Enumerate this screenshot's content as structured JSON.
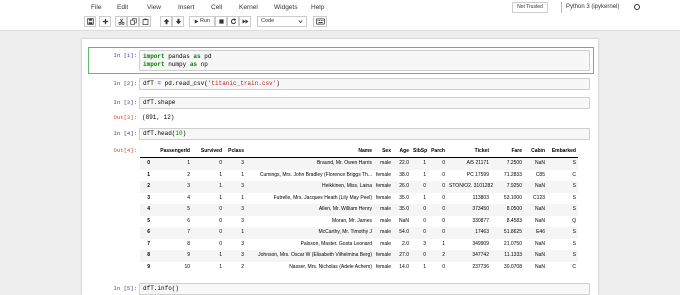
{
  "menu": {
    "items": [
      "File",
      "Edit",
      "View",
      "Insert",
      "Cell",
      "Kernel",
      "Widgets",
      "Help"
    ],
    "trust_label": "Not Trusted",
    "kernel_name": "Python 3 (ipykernel)",
    "kernel_status_icon": "circle-icon"
  },
  "toolbar": {
    "run_label": "Run",
    "cell_type": "Code",
    "icons": [
      "save-icon",
      "plus-icon",
      "cut-icon",
      "copy-icon",
      "paste-icon",
      "arrow-up-icon",
      "arrow-down-icon",
      "play-icon",
      "stop-icon",
      "restart-icon",
      "fast-forward-icon",
      "chevron-down-icon",
      "keyboard-icon"
    ]
  },
  "colors": {
    "selected_cell_border": "#66bb6a",
    "input_prompt": "#303f9f",
    "output_prompt": "#d84315",
    "keyword": "#008000",
    "string": "#ba2121",
    "number": "#008800",
    "operator": "#aa22ff"
  },
  "cells": [
    {
      "prompt": "In [1]:",
      "lines": [
        [
          "import",
          " pandas ",
          "as",
          " pd"
        ],
        [
          "import",
          " numpy ",
          "as",
          " np"
        ]
      ]
    },
    {
      "prompt": "In [2]:",
      "lines": [
        [
          "dfT ",
          "=",
          " pd.read_csv(",
          "'titanic_train.csv'",
          ")"
        ]
      ]
    },
    {
      "prompt": "In [3]:",
      "lines": [
        [
          "dfT.shape"
        ]
      ],
      "out_prompt": "Out[3]:",
      "output": "(891, 12)"
    },
    {
      "prompt": "In [4]:",
      "lines": [
        [
          "dfT.head(",
          "10",
          ")"
        ]
      ],
      "out_prompt": "Out[4]:",
      "table": {
        "columns": [
          "",
          "PassengerId",
          "Survived",
          "Pclass",
          "Name",
          "Sex",
          "Age",
          "SibSp",
          "Parch",
          "Ticket",
          "Fare",
          "Cabin",
          "Embarked"
        ],
        "rows": [
          [
            "0",
            "1",
            "0",
            "3",
            "Braund, Mr. Owen Harris",
            "male",
            "22.0",
            "1",
            "0",
            "A/5 21171",
            "7.2500",
            "NaN",
            "S"
          ],
          [
            "1",
            "2",
            "1",
            "1",
            "Cumings, Mrs. John Bradley (Florence Briggs Th...",
            "female",
            "38.0",
            "1",
            "0",
            "PC 17599",
            "71.2833",
            "C85",
            "C"
          ],
          [
            "2",
            "3",
            "1",
            "3",
            "Heikkinen, Miss. Laina",
            "female",
            "26.0",
            "0",
            "0",
            "STON/O2. 3101282",
            "7.9250",
            "NaN",
            "S"
          ],
          [
            "3",
            "4",
            "1",
            "1",
            "Futrelle, Mrs. Jacques Heath (Lily May Peel)",
            "female",
            "35.0",
            "1",
            "0",
            "113803",
            "53.1000",
            "C123",
            "S"
          ],
          [
            "4",
            "5",
            "0",
            "3",
            "Allen, Mr. William Henry",
            "male",
            "35.0",
            "0",
            "0",
            "373450",
            "8.0500",
            "NaN",
            "S"
          ],
          [
            "5",
            "6",
            "0",
            "3",
            "Moran, Mr. James",
            "male",
            "NaN",
            "0",
            "0",
            "330877",
            "8.4583",
            "NaN",
            "Q"
          ],
          [
            "6",
            "7",
            "0",
            "1",
            "McCarthy, Mr. Timothy J",
            "male",
            "54.0",
            "0",
            "0",
            "17463",
            "51.8625",
            "E46",
            "S"
          ],
          [
            "7",
            "8",
            "0",
            "3",
            "Palsson, Master. Gosta Leonard",
            "male",
            "2.0",
            "3",
            "1",
            "349909",
            "21.0750",
            "NaN",
            "S"
          ],
          [
            "8",
            "9",
            "1",
            "3",
            "Johnson, Mrs. Oscar W (Elisabeth Vilhelmina Berg)",
            "female",
            "27.0",
            "0",
            "2",
            "347742",
            "11.1333",
            "NaN",
            "S"
          ],
          [
            "9",
            "10",
            "1",
            "2",
            "Nasser, Mrs. Nicholas (Adele Achem)",
            "female",
            "14.0",
            "1",
            "0",
            "237736",
            "30.0708",
            "NaN",
            "C"
          ]
        ]
      }
    },
    {
      "prompt": "In [5]:",
      "lines": [
        [
          "dfT.info()"
        ]
      ]
    }
  ]
}
